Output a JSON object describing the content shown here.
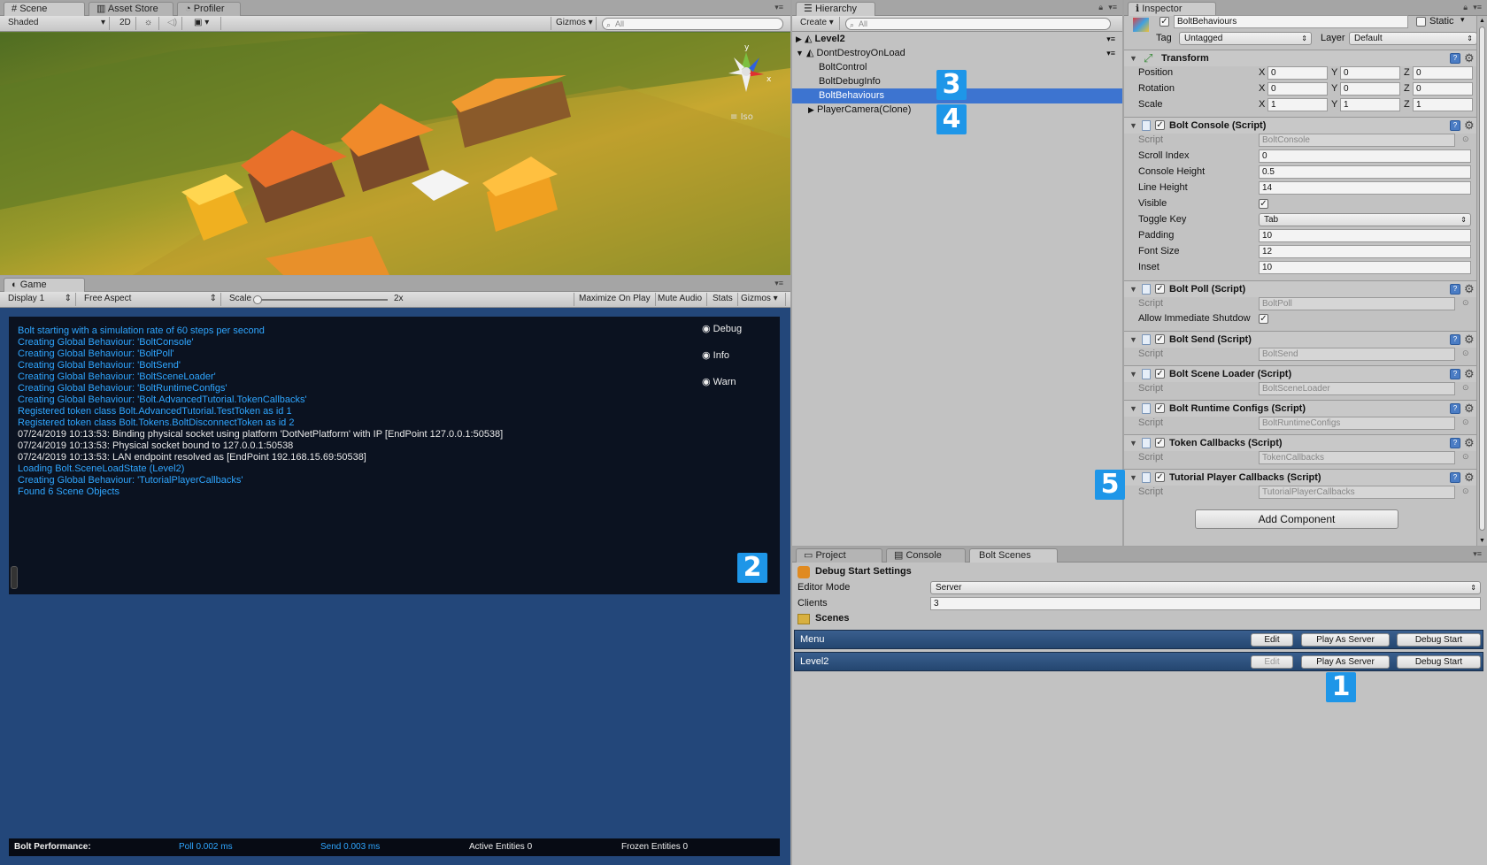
{
  "scene": {
    "tabs": [
      "Scene",
      "Asset Store",
      "Profiler"
    ],
    "toolbar": {
      "shading": "Shaded",
      "mode2d": "2D",
      "gizmos": "Gizmos",
      "search_placeholder": "All"
    },
    "iso_label": "Iso",
    "axes": {
      "x": "x",
      "y": "y"
    }
  },
  "game": {
    "tab": "Game",
    "toolbar": {
      "display": "Display 1",
      "aspect": "Free Aspect",
      "scale_label": "Scale",
      "scale_value": "2x",
      "maximize": "Maximize On Play",
      "mute": "Mute Audio",
      "stats": "Stats",
      "gizmos": "Gizmos"
    },
    "console_lines": [
      {
        "text": "Bolt starting with a simulation rate of 60 steps per second",
        "color": "#2fa6ff"
      },
      {
        "text": "Creating Global Behaviour: 'BoltConsole'",
        "color": "#2fa6ff"
      },
      {
        "text": "Creating Global Behaviour: 'BoltPoll'",
        "color": "#2fa6ff"
      },
      {
        "text": "Creating Global Behaviour: 'BoltSend'",
        "color": "#2fa6ff"
      },
      {
        "text": "Creating Global Behaviour: 'BoltSceneLoader'",
        "color": "#2fa6ff"
      },
      {
        "text": "Creating Global Behaviour: 'BoltRuntimeConfigs'",
        "color": "#2fa6ff"
      },
      {
        "text": "Creating Global Behaviour: 'Bolt.AdvancedTutorial.TokenCallbacks'",
        "color": "#2fa6ff"
      },
      {
        "text": "Registered token class Bolt.AdvancedTutorial.TestToken as id 1",
        "color": "#2fa6ff"
      },
      {
        "text": "Registered token class Bolt.Tokens.BoltDisconnectToken as id 2",
        "color": "#2fa6ff"
      },
      {
        "text": "07/24/2019 10:13:53: Binding physical socket using platform 'DotNetPlatform' with IP [EndPoint 127.0.0.1:50538]",
        "color": "#e8e8e8"
      },
      {
        "text": "07/24/2019 10:13:53: Physical socket bound to 127.0.0.1:50538",
        "color": "#e8e8e8"
      },
      {
        "text": "07/24/2019 10:13:53: LAN endpoint resolved as [EndPoint 192.168.15.69:50538]",
        "color": "#e8e8e8"
      },
      {
        "text": "Loading Bolt.SceneLoadState (Level2)",
        "color": "#2fa6ff"
      },
      {
        "text": "Creating Global Behaviour: 'TutorialPlayerCallbacks'",
        "color": "#2fa6ff"
      },
      {
        "text": "Found 6 Scene Objects",
        "color": "#2fa6ff"
      }
    ],
    "filters": [
      "Debug",
      "Info",
      "Warn"
    ],
    "perf": {
      "label": "Bolt Performance:",
      "poll": "Poll 0.002 ms",
      "send": "Send 0.003 ms",
      "active": "Active Entities 0",
      "frozen": "Frozen Entities 0"
    }
  },
  "hierarchy": {
    "tab": "Hierarchy",
    "create": "Create",
    "search_placeholder": "All",
    "items": [
      "Level2",
      "DontDestroyOnLoad",
      "BoltControl",
      "BoltDebugInfo",
      "BoltBehaviours",
      "PlayerCamera(Clone)"
    ],
    "selected": "BoltBehaviours"
  },
  "inspector": {
    "tab": "Inspector",
    "object_name": "BoltBehaviours",
    "static_label": "Static",
    "tag_label": "Tag",
    "tag_value": "Untagged",
    "layer_label": "Layer",
    "layer_value": "Default",
    "transform": {
      "title": "Transform",
      "rows": [
        {
          "label": "Position",
          "x": "0",
          "y": "0",
          "z": "0"
        },
        {
          "label": "Rotation",
          "x": "0",
          "y": "0",
          "z": "0"
        },
        {
          "label": "Scale",
          "x": "1",
          "y": "1",
          "z": "1"
        }
      ],
      "axis_labels": [
        "X",
        "Y",
        "Z"
      ]
    },
    "script_label": "Script",
    "console_comp": {
      "title": "Bolt Console (Script)",
      "script": "BoltConsole",
      "props": [
        {
          "label": "Scroll Index",
          "value": "0"
        },
        {
          "label": "Console Height",
          "value": "0.5"
        },
        {
          "label": "Line Height",
          "value": "14"
        }
      ],
      "visible_label": "Visible",
      "toggle_key_label": "Toggle Key",
      "toggle_key_value": "Tab",
      "props2": [
        {
          "label": "Padding",
          "value": "10"
        },
        {
          "label": "Font Size",
          "value": "12"
        },
        {
          "label": "Inset",
          "value": "10"
        }
      ]
    },
    "poll_comp": {
      "title": "Bolt Poll (Script)",
      "script": "BoltPoll",
      "allow_label": "Allow Immediate Shutdow"
    },
    "send_comp": {
      "title": "Bolt Send (Script)",
      "script": "BoltSend"
    },
    "loader_comp": {
      "title": "Bolt Scene Loader (Script)",
      "script": "BoltSceneLoader"
    },
    "runtime_comp": {
      "title": "Bolt Runtime Configs (Script)",
      "script": "BoltRuntimeConfigs"
    },
    "token_comp": {
      "title": "Token Callbacks (Script)",
      "script": "TokenCallbacks"
    },
    "tutorial_comp": {
      "title": "Tutorial Player Callbacks (Script)",
      "script": "TutorialPlayerCallbacks"
    },
    "add_component": "Add Component"
  },
  "bottom": {
    "tabs": [
      "Project",
      "Console",
      "Bolt Scenes"
    ],
    "debug_title": "Debug Start Settings",
    "editor_mode_label": "Editor Mode",
    "editor_mode_value": "Server",
    "clients_label": "Clients",
    "clients_value": "3",
    "scenes_label": "Scenes",
    "scenes": [
      {
        "name": "Menu",
        "edit": "Edit",
        "play": "Play As Server",
        "debug": "Debug Start"
      },
      {
        "name": "Level2",
        "edit": "Edit",
        "play": "Play As Server",
        "debug": "Debug Start"
      }
    ]
  },
  "callouts": [
    "1",
    "2",
    "3",
    "4",
    "5"
  ]
}
